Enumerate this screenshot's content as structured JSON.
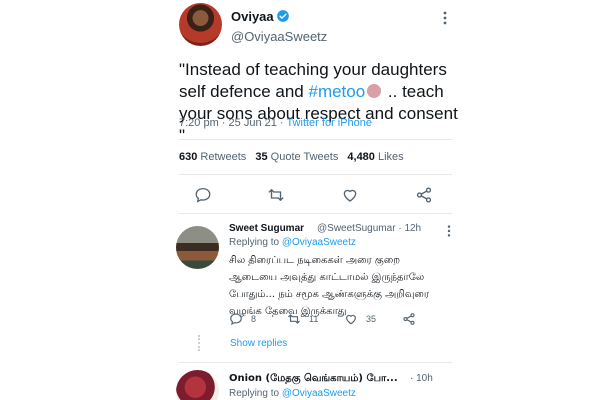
{
  "tweet": {
    "author_name": "Oviyaa",
    "author_handle": "@OviyaaSweetz",
    "text_part1": "\"Instead of teaching your daughters self defence and ",
    "hashtag": "#metoo",
    "text_part2": " .. teach your sons about respect and consent \"",
    "time": "7:20 pm",
    "date": "25 Jun 21",
    "source": "Twitter for iPhone",
    "retweets_count": "630",
    "retweets_label": "Retweets",
    "quotes_count": "35",
    "quotes_label": "Quote Tweets",
    "likes_count": "4,480",
    "likes_label": "Likes"
  },
  "reply1": {
    "name": "Sweet Sugumar",
    "handle": "@SweetSugumar",
    "time_sep": "·",
    "time": "12h",
    "replying_prefix": "Replying to",
    "replying_to": "@OviyaaSweetz",
    "text": "சில திரைப்பட நடிகைகள் அரை குறை ஆடையை அவுத்து காட்டாமல் இருந்தாலே போதும்... நம் சமூக ஆண்களுக்கு அறிவுரை வழங்க தேவை இருக்காது",
    "reply_count": "8",
    "retweet_count": "11",
    "like_count": "35"
  },
  "show_replies": "Show replies",
  "reply2": {
    "name": "Onion (மேதகு வெங்காயம்) போ...",
    "time_sep": "·",
    "time": "10h",
    "replying_prefix": "Replying to",
    "replying_to": "@OviyaaSweetz"
  },
  "colors": {
    "accent": "#1d9bf0",
    "muted": "#536471",
    "text": "#0f1419"
  },
  "icons": [
    "verified-icon",
    "more-icon",
    "reply-icon",
    "retweet-icon",
    "like-icon",
    "share-icon"
  ]
}
